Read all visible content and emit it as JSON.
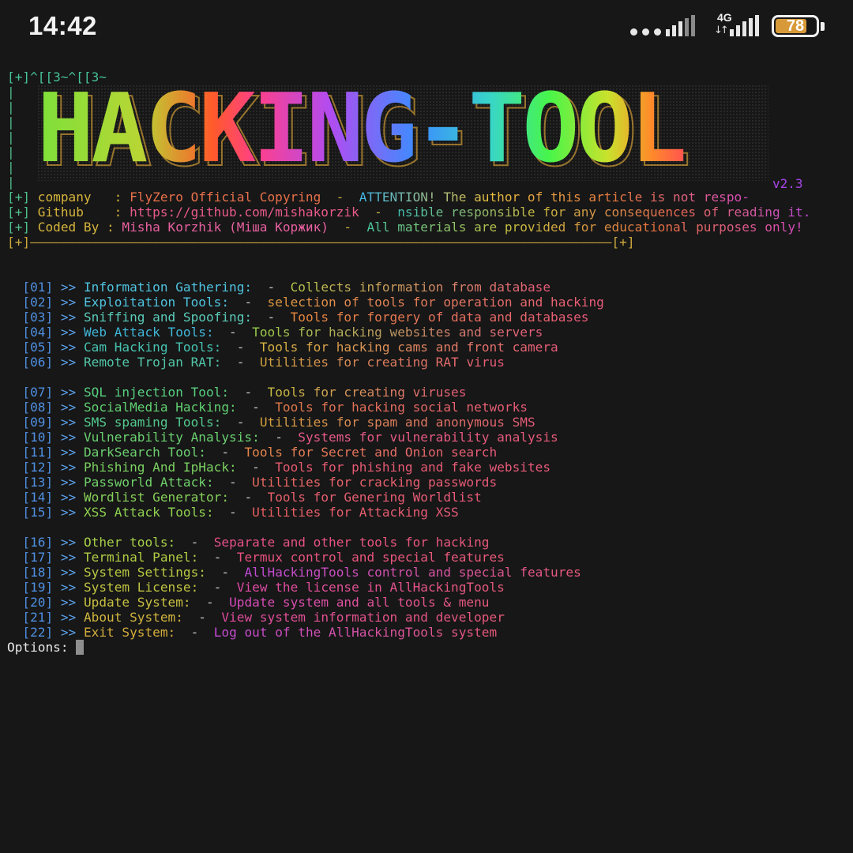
{
  "status_bar": {
    "time": "14:42",
    "network_label": "4G",
    "battery_level": "78",
    "battery_fraction": 0.78
  },
  "terminal": {
    "first_line": "[+]^[[3~^[[3~",
    "banner_title": "HACKING-TOOL",
    "version": "v2.3",
    "info_lines": [
      {
        "prefix": "[+]",
        "label": "company   : ",
        "value": "FlyZero Official Copyring",
        "sep": "  -  ",
        "note": "ATTENTION! The author of this article is not respo-"
      },
      {
        "prefix": "[+]",
        "label": "Github    : ",
        "value": "https://github.com/mishakorzik",
        "sep": "  -  ",
        "note": "nsible responsible for any consequences of reading it."
      },
      {
        "prefix": "[+]",
        "label": "Coded By : ",
        "value": "Misha Korzhik (Міша Коржик)",
        "sep": "  -  ",
        "note": "All materials are provided for educational purposes only!"
      }
    ],
    "separator_line": "[+]————————————————————————————————————————————————————————————————————————————[+]",
    "menu_groups": [
      [
        {
          "num": "[01]",
          "arrow": ">>",
          "name": "Information Gathering:",
          "desc": "Collects information from database",
          "c1": "#4fc3e0",
          "c2": "#b9c848"
        },
        {
          "num": "[02]",
          "arrow": ">>",
          "name": "Exploitation Tools:",
          "desc": "selection of tools for operation and hacking",
          "c1": "#4fc3e0",
          "c2": "#e09a40"
        },
        {
          "num": "[03]",
          "arrow": ">>",
          "name": "Sniffing and Spoofing:",
          "desc": "Tools for forgery of data and databases",
          "c1": "#5acbb8",
          "c2": "#e88a3c"
        },
        {
          "num": "[04]",
          "arrow": ">>",
          "name": "Web Attack Tools:",
          "desc": "Tools for hacking websites and servers",
          "c1": "#3fb6d8",
          "c2": "#9ad04a"
        },
        {
          "num": "[05]",
          "arrow": ">>",
          "name": "Cam Hacking Tools:",
          "desc": "Tools for hacking cams and front camera",
          "c1": "#46c3b0",
          "c2": "#d8b840"
        },
        {
          "num": "[06]",
          "arrow": ">>",
          "name": "Remote Trojan RAT:",
          "desc": "Utilities for creating RAT virus",
          "c1": "#52c6a8",
          "c2": "#d2a640"
        }
      ],
      [
        {
          "num": "[07]",
          "arrow": ">>",
          "name": "SQL injection Tool:",
          "desc": "Tools for creating viruses",
          "c1": "#58d080",
          "c2": "#c8c040"
        },
        {
          "num": "[08]",
          "arrow": ">>",
          "name": "SocialMedia Hacking:",
          "desc": "Tools for hacking social networks",
          "c1": "#60d070",
          "c2": "#e07a48"
        },
        {
          "num": "[09]",
          "arrow": ">>",
          "name": "SMS spaming Tools:",
          "desc": "Utilities for spam and anonymous SMS",
          "c1": "#52c98c",
          "c2": "#d6a43e"
        },
        {
          "num": "[10]",
          "arrow": ">>",
          "name": "Vulnerability Analysis:",
          "desc": "Systems for vulnerability analysis",
          "c1": "#6ad070",
          "c2": "#e85a8c"
        },
        {
          "num": "[11]",
          "arrow": ">>",
          "name": "DarkSearch Tool:",
          "desc": "Tools for Secret and Onion search",
          "c1": "#6cd070",
          "c2": "#e88a48"
        },
        {
          "num": "[12]",
          "arrow": ">>",
          "name": "Phishing And IpHack:",
          "desc": "Tools for phishing and fake websites",
          "c1": "#7ad060",
          "c2": "#e85a70"
        },
        {
          "num": "[13]",
          "arrow": ">>",
          "name": "Passworld Attack:",
          "desc": "Utilities for cracking passwords",
          "c1": "#70d06a",
          "c2": "#e86a60"
        },
        {
          "num": "[14]",
          "arrow": ">>",
          "name": "Wordlist Generator:",
          "desc": "Tools for Genering Worldlist",
          "c1": "#86d058",
          "c2": "#e8606a"
        },
        {
          "num": "[15]",
          "arrow": ">>",
          "name": "XSS Attack Tools:",
          "desc": "Utilities for Attacking XSS",
          "c1": "#8ed050",
          "c2": "#e86060"
        }
      ],
      [
        {
          "num": "[16]",
          "arrow": ">>",
          "name": "Other tools:",
          "desc": "Separate and other tools for hacking",
          "c1": "#a6cf48",
          "c2": "#e8508a"
        },
        {
          "num": "[17]",
          "arrow": ">>",
          "name": "Terminal Panel:",
          "desc": "Termux control and special features",
          "c1": "#b0cc44",
          "c2": "#e85080"
        },
        {
          "num": "[18]",
          "arrow": ">>",
          "name": "System Settings:",
          "desc": "AllHackingTools control and special features",
          "c1": "#b8c842",
          "c2": "#c04ad8"
        },
        {
          "num": "[19]",
          "arrow": ">>",
          "name": "System License:",
          "desc": "View the license in AllHackingTools",
          "c1": "#c0c440",
          "c2": "#e04aa8"
        },
        {
          "num": "[20]",
          "arrow": ">>",
          "name": "Update System:",
          "desc": "Update system and all tools & menu",
          "c1": "#c8c040",
          "c2": "#d84ac0"
        },
        {
          "num": "[21]",
          "arrow": ">>",
          "name": "About System:",
          "desc": "View system information and developer",
          "c1": "#d0b43e",
          "c2": "#e04aa0"
        },
        {
          "num": "[22]",
          "arrow": ">>",
          "name": "Exit System:",
          "desc": "Log out of the AllHackingTools system",
          "c1": "#d4ac3c",
          "c2": "#c44ad8"
        }
      ]
    ],
    "prompt": "Options: "
  }
}
